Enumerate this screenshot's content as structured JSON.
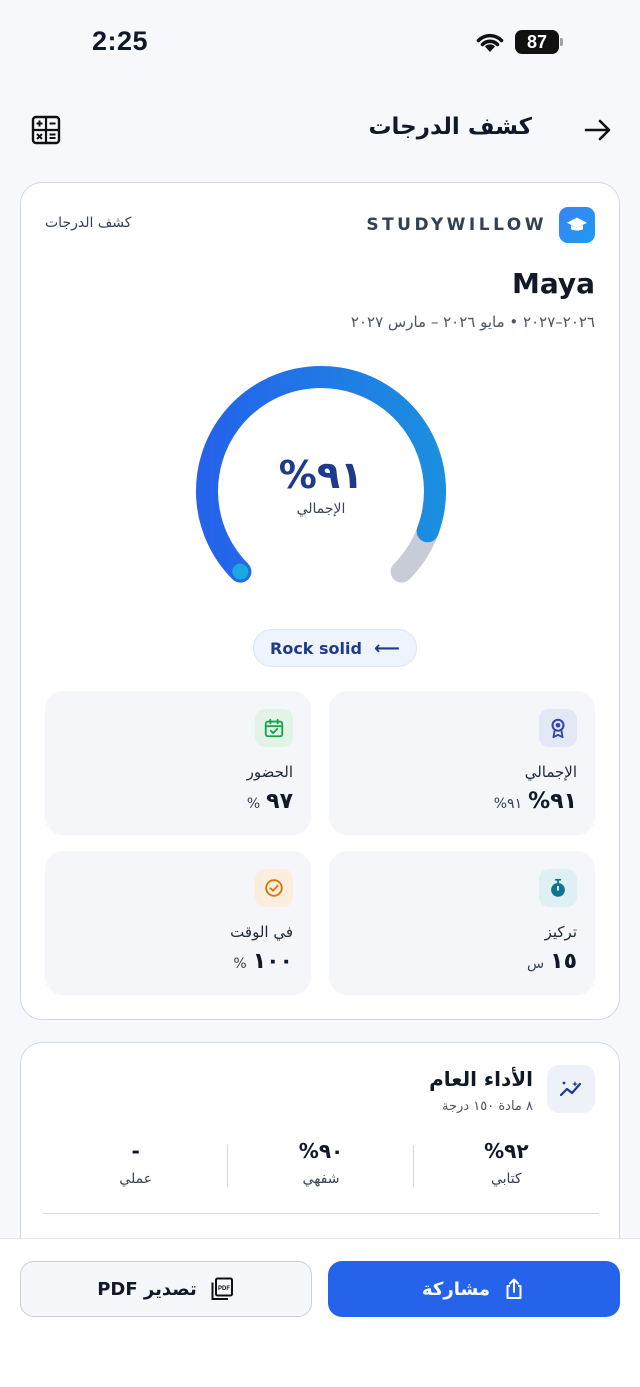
{
  "status_bar": {
    "time": "2:25",
    "battery": "87"
  },
  "header": {
    "title": "كشف الدرجات"
  },
  "report_card": {
    "brand": "STUDYWILLOW",
    "tag": "كشف الدرجات",
    "student_name": "Maya",
    "term_line": "٢٠٢٦–٢٠٢٧ • مايو ٢٠٢٦ – مارس ٢٠٢٧",
    "gauge": {
      "value": "٩١%",
      "label": "الإجمالي",
      "fraction": 0.91
    },
    "badge": "Rock solid",
    "tiles": [
      {
        "label": "الإجمالي",
        "value": "٩١%",
        "sub": "٩١%",
        "icon": "award-icon",
        "color": "#3347a8",
        "bg": "#e3e8f6"
      },
      {
        "label": "الحضور",
        "value": "٩٧",
        "sub": "%",
        "icon": "calendar-check-icon",
        "color": "#16a34a",
        "bg": "#e3f3e8"
      },
      {
        "label": "تركيز",
        "value": "١٥",
        "sub": "س",
        "icon": "stopwatch-icon",
        "color": "#0e7490",
        "bg": "#dff0f4"
      },
      {
        "label": "في الوقت",
        "value": "١٠٠",
        "sub": "%",
        "icon": "clock-check-icon",
        "color": "#d97706",
        "bg": "#fbeede"
      }
    ]
  },
  "performance": {
    "title": "الأداء العام",
    "subtitle": "٨ مادة ١٥٠ درجة",
    "columns": [
      {
        "value": "٩٢%",
        "label": "كتابي"
      },
      {
        "value": "٩٠%",
        "label": "شفهي"
      },
      {
        "value": "-",
        "label": "عملي"
      }
    ]
  },
  "actions": {
    "share": "مشاركة",
    "export_pdf": "تصدير PDF"
  },
  "colors": {
    "accent": "#2563eb",
    "gauge_track": "#c8ccd6"
  }
}
